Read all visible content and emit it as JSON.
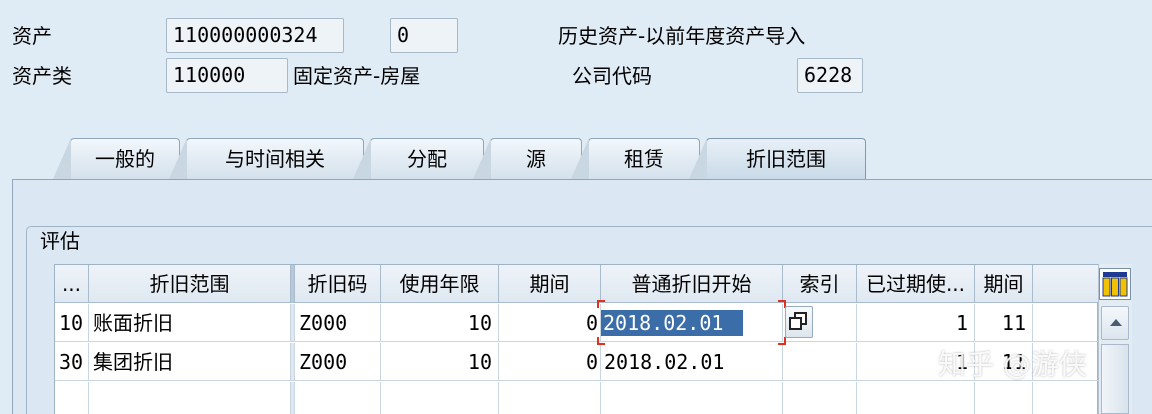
{
  "header": {
    "asset_label": "资产",
    "asset_number": "110000000324",
    "asset_sub": "0",
    "asset_desc": "历史资产-以前年度资产导入",
    "class_label": "资产类",
    "class_value": "110000",
    "class_desc": "固定资产-房屋",
    "company_label": "公司代码",
    "company_value": "6228"
  },
  "tabs": [
    {
      "label": "一般的",
      "active": false
    },
    {
      "label": "与时间相关",
      "active": false
    },
    {
      "label": "分配",
      "active": false
    },
    {
      "label": "源",
      "active": false
    },
    {
      "label": "租赁",
      "active": false
    },
    {
      "label": "折旧范围",
      "active": true
    }
  ],
  "group": {
    "title": "评估"
  },
  "table": {
    "columns": [
      "...",
      "折旧范围",
      "折旧码",
      "使用年限",
      "期间",
      "普通折旧开始",
      "索引",
      "已过期使...",
      "期间"
    ],
    "rows": [
      {
        "area": "10",
        "area_name": "账面折旧",
        "key": "Z000",
        "life_years": "10",
        "life_periods": "0",
        "start": "2018.02.01",
        "expired_years": "1",
        "expired_periods": "11"
      },
      {
        "area": "30",
        "area_name": "集团折旧",
        "key": "Z000",
        "life_years": "10",
        "life_periods": "0",
        "start": "2018.02.01",
        "expired_years": "1",
        "expired_periods": "11"
      }
    ]
  },
  "icons": {
    "column_config": "column-settings-icon",
    "index_button": "copy-window-icon",
    "scroll_up": "chevron-up-icon"
  },
  "watermark": "知乎 @游侠",
  "colors": {
    "background": "#dfebf5",
    "selection": "#3b6ea8",
    "focus_corner": "#e0301e"
  }
}
